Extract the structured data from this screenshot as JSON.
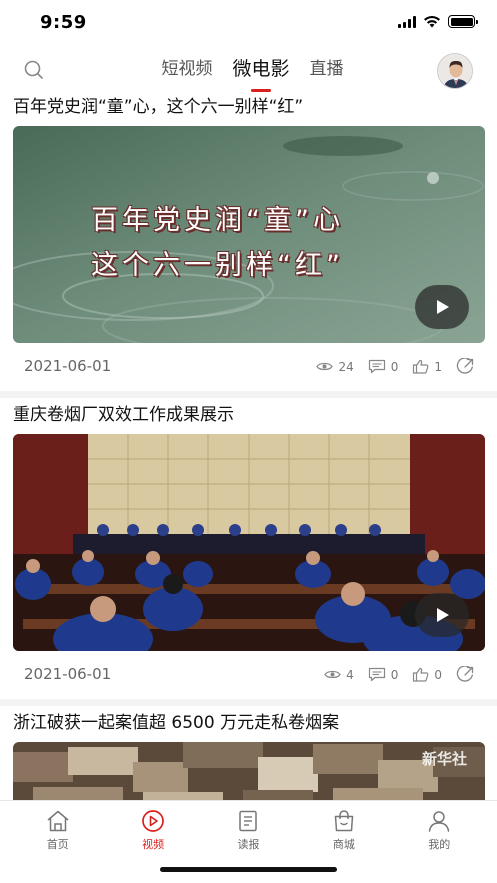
{
  "status_bar": {
    "time": "9:59"
  },
  "top_nav": {
    "tabs": [
      {
        "label": "短视频",
        "active": false
      },
      {
        "label": "微电影",
        "active": true
      },
      {
        "label": "直播",
        "active": false
      }
    ]
  },
  "feed": [
    {
      "title": "百年党史润“童”心，这个六一别样“红”",
      "video_caption_line1": "百年党史润“童”心",
      "video_caption_line2": "这个六一别样“红”",
      "date": "2021-06-01",
      "views": "24",
      "comments": "0",
      "likes": "1"
    },
    {
      "title": "重庆卷烟厂双效工作成果展示",
      "date": "2021-06-01",
      "views": "4",
      "comments": "0",
      "likes": "0"
    },
    {
      "title": "浙江破获一起案值超 6500 万元走私卷烟案",
      "watermark": "新华社"
    }
  ],
  "bottom_nav": [
    {
      "label": "首页",
      "icon": "home-icon",
      "active": false
    },
    {
      "label": "视频",
      "icon": "video-icon",
      "active": true
    },
    {
      "label": "读报",
      "icon": "newspaper-icon",
      "active": false
    },
    {
      "label": "商城",
      "icon": "shopping-bag-icon",
      "active": false
    },
    {
      "label": "我的",
      "icon": "person-icon",
      "active": false
    }
  ],
  "colors": {
    "accent": "#d9201f",
    "text": "#111111",
    "muted": "#777777"
  }
}
